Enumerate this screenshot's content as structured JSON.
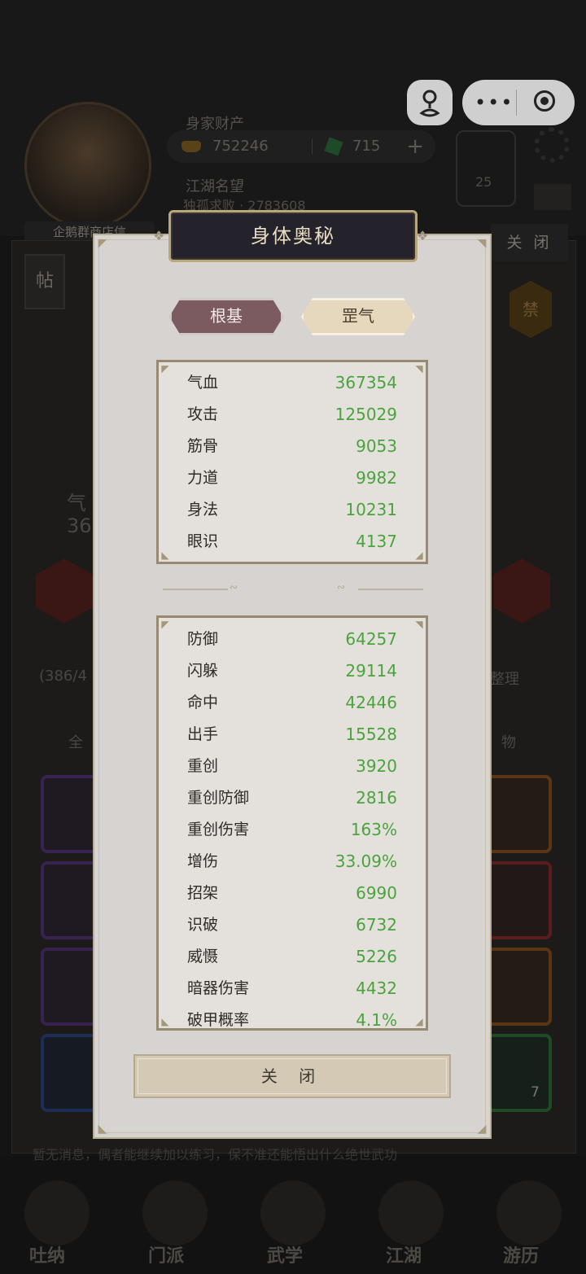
{
  "background": {
    "wealth_label": "身家财产",
    "gold_value": "752246",
    "jade_value": "715",
    "fame_label": "江湖名望",
    "fame_text": "独孤求败 · 2783608",
    "player_name": "企鹅群商店信",
    "taiji_count": "25",
    "close_tab_label": "关 闭",
    "post_label": "帖",
    "ban_label": "禁",
    "bag_capacity": "(386/4",
    "sort_label": "整理",
    "filter_all": "全",
    "filter_item": "物",
    "hp_label": "气",
    "hp_value": "36",
    "item_count": "7",
    "ticker": "暂无消息，偶者能继续加以练习，保不准还能悟出什么绝世武功",
    "nav": [
      "吐纳",
      "门派",
      "武学",
      "江湖",
      "游历"
    ]
  },
  "dialog": {
    "title": "身体奥秘",
    "tabs": [
      {
        "label": "根基",
        "active": true
      },
      {
        "label": "罡气",
        "active": false
      }
    ],
    "base_stats": [
      {
        "name": "气血",
        "value": "367354"
      },
      {
        "name": "攻击",
        "value": "125029"
      },
      {
        "name": "筋骨",
        "value": "9053"
      },
      {
        "name": "力道",
        "value": "9982"
      },
      {
        "name": "身法",
        "value": "10231"
      },
      {
        "name": "眼识",
        "value": "4137"
      }
    ],
    "combat_stats": [
      {
        "name": "防御",
        "value": "64257"
      },
      {
        "name": "闪躲",
        "value": "29114"
      },
      {
        "name": "命中",
        "value": "42446"
      },
      {
        "name": "出手",
        "value": "15528"
      },
      {
        "name": "重创",
        "value": "3920"
      },
      {
        "name": "重创防御",
        "value": "2816"
      },
      {
        "name": "重创伤害",
        "value": "163%"
      },
      {
        "name": "增伤",
        "value": "33.09%"
      },
      {
        "name": "招架",
        "value": "6990"
      },
      {
        "name": "识破",
        "value": "6732"
      },
      {
        "name": "威慑",
        "value": "5226"
      },
      {
        "name": "暗器伤害",
        "value": "4432"
      },
      {
        "name": "破甲概率",
        "value": "4.1%"
      }
    ],
    "close_label": "关 闭"
  },
  "colors": {
    "value_green": "#4aa33c",
    "tab_active": "#7b5a60",
    "tab_inactive": "#e6d8bd",
    "title_plate": "#24222b"
  },
  "icons": [
    "user-pin-icon",
    "more-dots-icon",
    "record-target-icon",
    "gold-ingot-icon",
    "jade-icon",
    "taiji-icon",
    "settings-gear-icon",
    "mail-icon"
  ]
}
